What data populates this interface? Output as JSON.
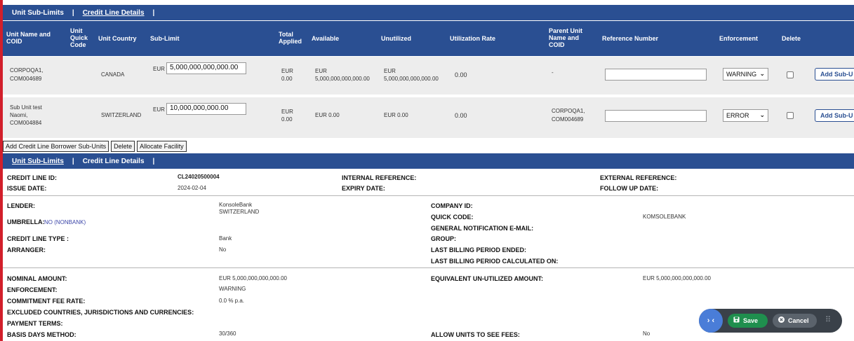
{
  "tabs_top": {
    "unit_sub_limits": "Unit Sub-Limits",
    "credit_line_details": "Credit Line Details",
    "sep": "|"
  },
  "table": {
    "headers": {
      "unit_name": "Unit Name and COID",
      "quick_code": "Unit Quick Code",
      "country": "Unit Country",
      "sub_limit": "Sub-Limit",
      "total_applied": "Total Applied",
      "available": "Available",
      "unutilized": "Unutilized",
      "utilization_rate": "Utilization Rate",
      "parent_unit": "Parent Unit Name and COID",
      "reference_number": "Reference Number",
      "enforcement": "Enforcement",
      "delete": "Delete"
    },
    "rows": [
      {
        "unit_name": "CORPOQA1,",
        "coid": "COM004689",
        "country": "CANADA",
        "sub_limit_currency": "EUR",
        "sub_limit": "5,000,000,000,000.00",
        "total_applied_currency": "EUR",
        "total_applied": "0.00",
        "available_currency": "EUR",
        "available": "5,000,000,000,000.00",
        "unutilized_currency": "EUR",
        "unutilized": "5,000,000,000,000.00",
        "utilization_rate": "0.00",
        "parent_unit": "-",
        "parent_coid": "",
        "enforcement": "WARNING",
        "add_label": "Add Sub-U"
      },
      {
        "unit_name": "Sub Unit test",
        "unit_name2": "Naomi,",
        "coid": "COM004884",
        "country": "SWITZERLAND",
        "sub_limit_currency": "EUR",
        "sub_limit": "10,000,000,000.00",
        "total_applied_currency": "EUR",
        "total_applied": "0.00",
        "available": "EUR 0.00",
        "unutilized": "EUR 0.00",
        "utilization_rate": "0.00",
        "parent_unit": "CORPOQA1,",
        "parent_coid": "COM004689",
        "enforcement": "ERROR",
        "add_label": "Add Sub-U"
      }
    ]
  },
  "actions": {
    "add_borrower": "Add Credit Line Borrower Sub-Units",
    "delete": "Delete",
    "allocate": "Allocate Facility"
  },
  "tabs_bottom": {
    "unit_sub_limits": "Unit Sub-Limits",
    "credit_line_details": "Credit Line Details",
    "sep": "|"
  },
  "details": {
    "credit_line_id_label": "CREDIT LINE ID:",
    "credit_line_id": "CL24020500004",
    "issue_date_label": "ISSUE DATE:",
    "issue_date": "2024-02-04",
    "internal_reference_label": "INTERNAL REFERENCE:",
    "expiry_date_label": "EXPIRY DATE:",
    "external_reference_label": "EXTERNAL REFERENCE:",
    "follow_up_date_label": "FOLLOW UP DATE:",
    "lender_label": "LENDER:",
    "lender_name": "KonsoleBank",
    "lender_country": "SWITZERLAND",
    "umbrella_label": "UMBRELLA:",
    "umbrella_value": "NO (NONBANK)",
    "credit_line_type_label": "CREDIT LINE TYPE :",
    "credit_line_type": "Bank",
    "arranger_label": "ARRANGER:",
    "arranger": "No",
    "company_id_label": "COMPANY ID:",
    "quick_code_label": "QUICK CODE:",
    "quick_code": "KOMSOLEBANK",
    "general_notification_label": "GENERAL NOTIFICATION E-MAIL:",
    "group_label": "GROUP:",
    "last_billing_ended_label": "LAST BILLING PERIOD ENDED:",
    "last_billing_calculated_label": "LAST BILLING PERIOD CALCULATED ON:",
    "nominal_amount_label": "NOMINAL AMOUNT:",
    "nominal_amount": "EUR  5,000,000,000,000.00",
    "enforcement_label": "ENFORCEMENT:",
    "enforcement": "WARNING",
    "commitment_fee_label": "COMMITMENT FEE RATE:",
    "commitment_fee": "0.0 % p.a.",
    "excluded_label": "EXCLUDED COUNTRIES, JURISDICTIONS AND CURRENCIES:",
    "payment_terms_label": "PAYMENT TERMS:",
    "basis_days_label": "BASIS DAYS METHOD:",
    "basis_days": "30/360",
    "equivalent_unutilized_label": "EQUIVALENT UN-UTILIZED AMOUNT:",
    "equivalent_unutilized": "EUR  5,000,000,000,000.00",
    "allow_units_label": "ALLOW UNITS TO SEE FEES:",
    "allow_units": "No"
  },
  "floating_bar": {
    "toggle": "› ‹",
    "save": "Save",
    "cancel": "Cancel",
    "grip": "⠿"
  }
}
